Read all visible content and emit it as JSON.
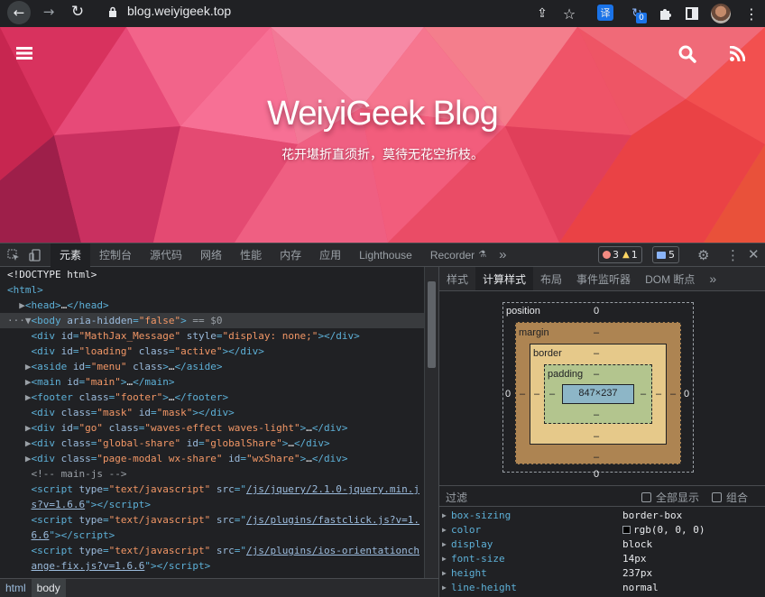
{
  "browser": {
    "url": "blog.weiyigeek.top",
    "translate_icon": "译",
    "extension_badge": "0"
  },
  "hero": {
    "title": "WeiyiGeek Blog",
    "subtitle": "花开堪折直须折，莫待无花空折枝。"
  },
  "devtools": {
    "tabs": [
      "元素",
      "控制台",
      "源代码",
      "网络",
      "性能",
      "内存",
      "应用",
      "Lighthouse",
      "Recorder"
    ],
    "more": "»",
    "errors": "3",
    "warnings": "1",
    "messages": "5"
  },
  "elements": [
    {
      "html": "<span>&lt;!DOCTYPE html&gt;</span>"
    },
    {
      "html": "<span class=\"tag\">&lt;html&gt;</span>"
    },
    {
      "html": "  <span class=\"dim\">▶</span><span class=\"tag\">&lt;head&gt;</span>…<span class=\"tag\">&lt;/head&gt;</span>"
    },
    {
      "html": "<span class=\"dim\">···▼</span><span class=\"tag\">&lt;body </span><span class=\"attr\">aria-hidden</span><span class=\"tag\">=</span><span class=\"val\">\"false\"</span><span class=\"tag\">&gt;</span> <span class=\"dim\">== $0</span>",
      "selected": true
    },
    {
      "html": "    <span class=\"tag\">&lt;div </span><span class=\"attr\">id</span><span class=\"tag\">=</span><span class=\"val\">\"MathJax_Message\"</span> <span class=\"attr\">style</span><span class=\"tag\">=</span><span class=\"val\">\"display: none;\"</span><span class=\"tag\">&gt;&lt;/div&gt;</span>"
    },
    {
      "html": "    <span class=\"tag\">&lt;div </span><span class=\"attr\">id</span><span class=\"tag\">=</span><span class=\"val\">\"loading\"</span> <span class=\"attr\">class</span><span class=\"tag\">=</span><span class=\"val\">\"active\"</span><span class=\"tag\">&gt;&lt;/div&gt;</span>"
    },
    {
      "html": "   <span class=\"dim\">▶</span><span class=\"tag\">&lt;aside </span><span class=\"attr\">id</span><span class=\"tag\">=</span><span class=\"val\">\"menu\"</span> <span class=\"attr\">class</span><span class=\"tag\">&gt;</span>…<span class=\"tag\">&lt;/aside&gt;</span>"
    },
    {
      "html": "   <span class=\"dim\">▶</span><span class=\"tag\">&lt;main </span><span class=\"attr\">id</span><span class=\"tag\">=</span><span class=\"val\">\"main\"</span><span class=\"tag\">&gt;</span>…<span class=\"tag\">&lt;/main&gt;</span>"
    },
    {
      "html": "   <span class=\"dim\">▶</span><span class=\"tag\">&lt;footer </span><span class=\"attr\">class</span><span class=\"tag\">=</span><span class=\"val\">\"footer\"</span><span class=\"tag\">&gt;</span>…<span class=\"tag\">&lt;/footer&gt;</span>"
    },
    {
      "html": "    <span class=\"tag\">&lt;div </span><span class=\"attr\">class</span><span class=\"tag\">=</span><span class=\"val\">\"mask\"</span> <span class=\"attr\">id</span><span class=\"tag\">=</span><span class=\"val\">\"mask\"</span><span class=\"tag\">&gt;&lt;/div&gt;</span>"
    },
    {
      "html": "   <span class=\"dim\">▶</span><span class=\"tag\">&lt;div </span><span class=\"attr\">id</span><span class=\"tag\">=</span><span class=\"val\">\"go\"</span> <span class=\"attr\">class</span><span class=\"tag\">=</span><span class=\"val\">\"waves-effect waves-light\"</span><span class=\"tag\">&gt;</span>…<span class=\"tag\">&lt;/div&gt;</span>"
    },
    {
      "html": "   <span class=\"dim\">▶</span><span class=\"tag\">&lt;div </span><span class=\"attr\">class</span><span class=\"tag\">=</span><span class=\"val\">\"global-share\"</span> <span class=\"attr\">id</span><span class=\"tag\">=</span><span class=\"val\">\"globalShare\"</span><span class=\"tag\">&gt;</span>…<span class=\"tag\">&lt;/div&gt;</span>"
    },
    {
      "html": "   <span class=\"dim\">▶</span><span class=\"tag\">&lt;div </span><span class=\"attr\">class</span><span class=\"tag\">=</span><span class=\"val\">\"page-modal wx-share\"</span> <span class=\"attr\">id</span><span class=\"tag\">=</span><span class=\"val\">\"wxShare\"</span><span class=\"tag\">&gt;</span>…<span class=\"tag\">&lt;/div&gt;</span>"
    },
    {
      "html": "    <span class=\"cmt\">&lt;!-- main-js --&gt;</span>"
    },
    {
      "html": "    <span class=\"tag\">&lt;script </span><span class=\"attr\">type</span><span class=\"tag\">=</span><span class=\"val\">\"text/javascript\"</span> <span class=\"attr\">src</span><span class=\"tag\">=\"</span><span class=\"lnk\">/js/jquery/2.1.0-jquery.min.j</span>"
    },
    {
      "html": "    <span class=\"lnk\">s?v=1.6.6</span><span class=\"tag\">\"&gt;&lt;/script&gt;</span>"
    },
    {
      "html": "    <span class=\"tag\">&lt;script </span><span class=\"attr\">type</span><span class=\"tag\">=</span><span class=\"val\">\"text/javascript\"</span> <span class=\"attr\">src</span><span class=\"tag\">=\"</span><span class=\"lnk\">/js/plugins/fastclick.js?v=1.</span>"
    },
    {
      "html": "    <span class=\"lnk\">6.6</span><span class=\"tag\">\"&gt;&lt;/script&gt;</span>"
    },
    {
      "html": "    <span class=\"tag\">&lt;script </span><span class=\"attr\">type</span><span class=\"tag\">=</span><span class=\"val\">\"text/javascript\"</span> <span class=\"attr\">src</span><span class=\"tag\">=\"</span><span class=\"lnk\">/js/plugins/ios-orientationch</span>"
    },
    {
      "html": "    <span class=\"lnk\">ange-fix.js?v=1.6.6</span><span class=\"tag\">\"&gt;&lt;/script&gt;</span>"
    }
  ],
  "breadcrumbs": [
    "html",
    "body"
  ],
  "side_tabs": [
    "样式",
    "计算样式",
    "布局",
    "事件监听器",
    "DOM 断点",
    "»"
  ],
  "box_model": {
    "position_label": "position",
    "position_value": "0",
    "margin_label": "margin",
    "border_label": "border",
    "padding_label": "padding",
    "dash": "–",
    "content_size": "847×237",
    "zero": "0"
  },
  "filter": {
    "placeholder": "过滤",
    "show_all": "全部显示",
    "group": "组合"
  },
  "computed": [
    {
      "name": "box-sizing",
      "value": "border-box"
    },
    {
      "name": "color",
      "value": "rgb(0, 0, 0)",
      "swatch": "#000000"
    },
    {
      "name": "display",
      "value": "block"
    },
    {
      "name": "font-size",
      "value": "14px"
    },
    {
      "name": "height",
      "value": "237px"
    },
    {
      "name": "line-height",
      "value": "normal"
    }
  ],
  "colors": {
    "margin": "#ad8452",
    "border": "#e6c98a",
    "padding": "#b3c58e",
    "content": "#8db6c7"
  }
}
